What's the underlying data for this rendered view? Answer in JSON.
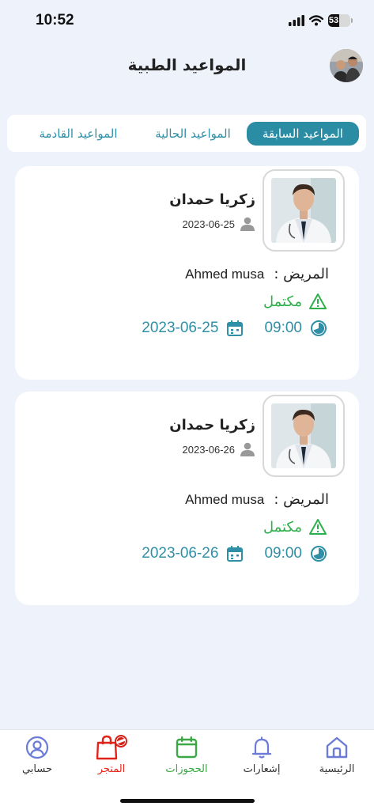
{
  "status_bar": {
    "time": "10:52",
    "battery": "53"
  },
  "header": {
    "title": "المواعيد الطبية"
  },
  "tabs": [
    {
      "label": "المواعيد السابقة",
      "active": true
    },
    {
      "label": "المواعيد الحالية",
      "active": false
    },
    {
      "label": "المواعيد القادمة",
      "active": false
    }
  ],
  "appointments": [
    {
      "doctor_name": "زكريا حمدان",
      "booking_date": "2023-06-25",
      "patient_label": "المريض :",
      "patient_name": "Ahmed musa",
      "status": "مكتمل",
      "time": "09:00",
      "date": "2023-06-25"
    },
    {
      "doctor_name": "زكريا حمدان",
      "booking_date": "2023-06-26",
      "patient_label": "المريض :",
      "patient_name": "Ahmed musa",
      "status": "مكتمل",
      "time": "09:00",
      "date": "2023-06-26"
    }
  ],
  "bottom_nav": [
    {
      "label": "الرئيسية",
      "icon": "home-icon",
      "color": "#6c7bd6"
    },
    {
      "label": "إشعارات",
      "icon": "bell-icon",
      "color": "#6c7bd6"
    },
    {
      "label": "الحجوزات",
      "icon": "calendar-icon",
      "color": "#3aa844"
    },
    {
      "label": "المتجر",
      "icon": "shopping-bag-icon",
      "color": "#e2231a",
      "badge": "COMING SOON"
    },
    {
      "label": "حسابي",
      "icon": "user-circle-icon",
      "color": "#6c7bd6"
    }
  ],
  "colors": {
    "accent": "#2a8da4",
    "success": "#2db04b",
    "background": "#eef2fb"
  }
}
